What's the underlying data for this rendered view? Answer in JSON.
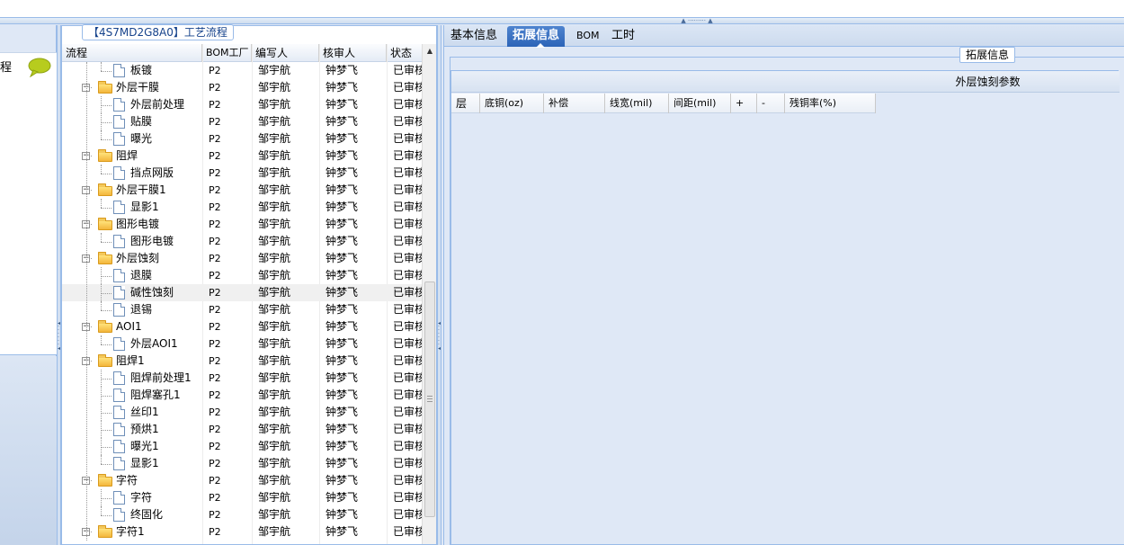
{
  "left_panel": {
    "label": "程",
    "chat_icon": "speech-bubble-icon"
  },
  "tree_panel": {
    "title": "【4S7MD2G8A0】工艺流程",
    "columns": [
      "流程",
      "BOM工厂",
      "编写人",
      "核审人",
      "状态"
    ],
    "rows": [
      {
        "name": "板镀",
        "type": "doc",
        "level": 2,
        "bom": "P2",
        "writer": "邹宇航",
        "reviewer": "钟梦飞",
        "status": "已审核"
      },
      {
        "name": "外层干膜",
        "type": "folder",
        "level": 1,
        "bom": "P2",
        "writer": "邹宇航",
        "reviewer": "钟梦飞",
        "status": "已审核"
      },
      {
        "name": "外层前处理",
        "type": "doc",
        "level": 2,
        "bom": "P2",
        "writer": "邹宇航",
        "reviewer": "钟梦飞",
        "status": "已审核"
      },
      {
        "name": "贴膜",
        "type": "doc",
        "level": 2,
        "bom": "P2",
        "writer": "邹宇航",
        "reviewer": "钟梦飞",
        "status": "已审核"
      },
      {
        "name": "曝光",
        "type": "doc",
        "level": 2,
        "bom": "P2",
        "writer": "邹宇航",
        "reviewer": "钟梦飞",
        "status": "已审核"
      },
      {
        "name": "阻焊",
        "type": "folder",
        "level": 1,
        "bom": "P2",
        "writer": "邹宇航",
        "reviewer": "钟梦飞",
        "status": "已审核"
      },
      {
        "name": "挡点网版",
        "type": "doc",
        "level": 2,
        "bom": "P2",
        "writer": "邹宇航",
        "reviewer": "钟梦飞",
        "status": "已审核"
      },
      {
        "name": "外层干膜1",
        "type": "folder",
        "level": 1,
        "bom": "P2",
        "writer": "邹宇航",
        "reviewer": "钟梦飞",
        "status": "已审核"
      },
      {
        "name": "显影1",
        "type": "doc",
        "level": 2,
        "bom": "P2",
        "writer": "邹宇航",
        "reviewer": "钟梦飞",
        "status": "已审核"
      },
      {
        "name": "图形电镀",
        "type": "folder",
        "level": 1,
        "bom": "P2",
        "writer": "邹宇航",
        "reviewer": "钟梦飞",
        "status": "已审核"
      },
      {
        "name": "图形电镀",
        "type": "doc",
        "level": 2,
        "bom": "P2",
        "writer": "邹宇航",
        "reviewer": "钟梦飞",
        "status": "已审核"
      },
      {
        "name": "外层蚀刻",
        "type": "folder",
        "level": 1,
        "bom": "P2",
        "writer": "邹宇航",
        "reviewer": "钟梦飞",
        "status": "已审核"
      },
      {
        "name": "退膜",
        "type": "doc",
        "level": 2,
        "bom": "P2",
        "writer": "邹宇航",
        "reviewer": "钟梦飞",
        "status": "已审核"
      },
      {
        "name": "碱性蚀刻",
        "type": "doc",
        "level": 2,
        "bom": "P2",
        "writer": "邹宇航",
        "reviewer": "钟梦飞",
        "status": "已审核",
        "selected": true
      },
      {
        "name": "退锡",
        "type": "doc",
        "level": 2,
        "bom": "P2",
        "writer": "邹宇航",
        "reviewer": "钟梦飞",
        "status": "已审核"
      },
      {
        "name": "AOI1",
        "type": "folder",
        "level": 1,
        "bom": "P2",
        "writer": "邹宇航",
        "reviewer": "钟梦飞",
        "status": "已审核"
      },
      {
        "name": "外层AOI1",
        "type": "doc",
        "level": 2,
        "bom": "P2",
        "writer": "邹宇航",
        "reviewer": "钟梦飞",
        "status": "已审核"
      },
      {
        "name": "阻焊1",
        "type": "folder",
        "level": 1,
        "bom": "P2",
        "writer": "邹宇航",
        "reviewer": "钟梦飞",
        "status": "已审核"
      },
      {
        "name": "阻焊前处理1",
        "type": "doc",
        "level": 2,
        "bom": "P2",
        "writer": "邹宇航",
        "reviewer": "钟梦飞",
        "status": "已审核"
      },
      {
        "name": "阻焊塞孔1",
        "type": "doc",
        "level": 2,
        "bom": "P2",
        "writer": "邹宇航",
        "reviewer": "钟梦飞",
        "status": "已审核"
      },
      {
        "name": "丝印1",
        "type": "doc",
        "level": 2,
        "bom": "P2",
        "writer": "邹宇航",
        "reviewer": "钟梦飞",
        "status": "已审核"
      },
      {
        "name": "预烘1",
        "type": "doc",
        "level": 2,
        "bom": "P2",
        "writer": "邹宇航",
        "reviewer": "钟梦飞",
        "status": "已审核"
      },
      {
        "name": "曝光1",
        "type": "doc",
        "level": 2,
        "bom": "P2",
        "writer": "邹宇航",
        "reviewer": "钟梦飞",
        "status": "已审核"
      },
      {
        "name": "显影1",
        "type": "doc",
        "level": 2,
        "bom": "P2",
        "writer": "邹宇航",
        "reviewer": "钟梦飞",
        "status": "已审核"
      },
      {
        "name": "字符",
        "type": "folder",
        "level": 1,
        "bom": "P2",
        "writer": "邹宇航",
        "reviewer": "钟梦飞",
        "status": "已审核"
      },
      {
        "name": "字符",
        "type": "doc",
        "level": 2,
        "bom": "P2",
        "writer": "邹宇航",
        "reviewer": "钟梦飞",
        "status": "已审核"
      },
      {
        "name": "终固化",
        "type": "doc",
        "level": 2,
        "bom": "P2",
        "writer": "邹宇航",
        "reviewer": "钟梦飞",
        "status": "已审核"
      },
      {
        "name": "字符1",
        "type": "folder",
        "level": 1,
        "bom": "P2",
        "writer": "邹宇航",
        "reviewer": "钟梦飞",
        "status": "已审核"
      }
    ]
  },
  "right_panel": {
    "tabs": [
      {
        "label": "基本信息",
        "active": false
      },
      {
        "label": "拓展信息",
        "active": true
      },
      {
        "label": "BOM",
        "active": false
      },
      {
        "label": "工时",
        "active": false
      }
    ],
    "fieldset_legend": "拓展信息",
    "grid_title": "外层蚀刻参数",
    "grid_columns": [
      "层",
      "底铜(oz)",
      "补偿",
      "线宽(mil)",
      "间距(mil)",
      "+",
      "-",
      "残铜率(%)"
    ]
  }
}
